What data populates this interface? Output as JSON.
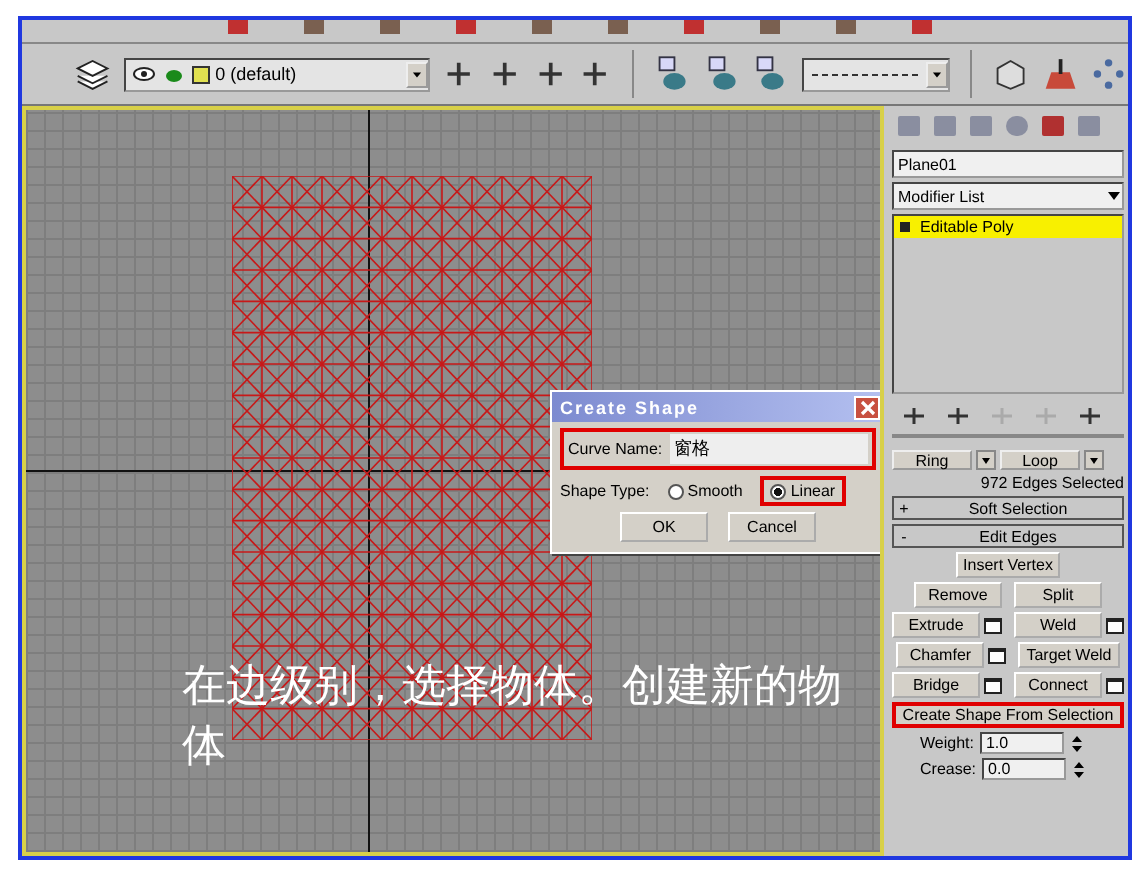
{
  "toolbar": {
    "layer_dropdown": "0 (default)"
  },
  "viewport": {
    "caption": "在边级别，选择物体。创建新的物体"
  },
  "dialog": {
    "title": "Create Shape",
    "curve_name_label": "Curve Name:",
    "curve_name": "窗格",
    "curve_name_highlighted": true,
    "shape_type_label": "Shape Type:",
    "options": [
      {
        "label": "Smooth",
        "selected": false,
        "highlighted": false
      },
      {
        "label": "Linear",
        "selected": true,
        "highlighted": true
      }
    ],
    "buttons": [
      "OK",
      "Cancel"
    ]
  },
  "command_panel": {
    "object_name": "Plane01",
    "modifier_list": "Modifier List",
    "stack": [
      {
        "label": "Editable Poly",
        "selected": true
      }
    ],
    "ring": "Ring",
    "loop": "Loop",
    "selection_info": "972 Edges Selected",
    "rollouts": [
      {
        "sign": "+",
        "title": "Soft Selection"
      },
      {
        "sign": "-",
        "title": "Edit Edges"
      }
    ],
    "button_rows": [
      [
        {
          "label": "Insert Vertex",
          "settings": false,
          "highlighted": false
        }
      ],
      [
        {
          "label": "Remove",
          "settings": false,
          "highlighted": false
        },
        {
          "label": "Split",
          "settings": false,
          "highlighted": false
        }
      ],
      [
        {
          "label": "Extrude",
          "settings": true,
          "highlighted": false
        },
        {
          "label": "Weld",
          "settings": true,
          "highlighted": false
        }
      ],
      [
        {
          "label": "Chamfer",
          "settings": true,
          "highlighted": false
        },
        {
          "label": "Target Weld",
          "settings": false,
          "highlighted": false
        }
      ],
      [
        {
          "label": "Bridge",
          "settings": true,
          "highlighted": false
        },
        {
          "label": "Connect",
          "settings": true,
          "highlighted": false
        }
      ],
      [
        {
          "label": "Create Shape From Selection",
          "settings": false,
          "highlighted": true
        }
      ]
    ],
    "spinners": [
      {
        "label": "Weight:",
        "value": "1.0"
      },
      {
        "label": "Crease:",
        "value": "0.0"
      }
    ]
  }
}
